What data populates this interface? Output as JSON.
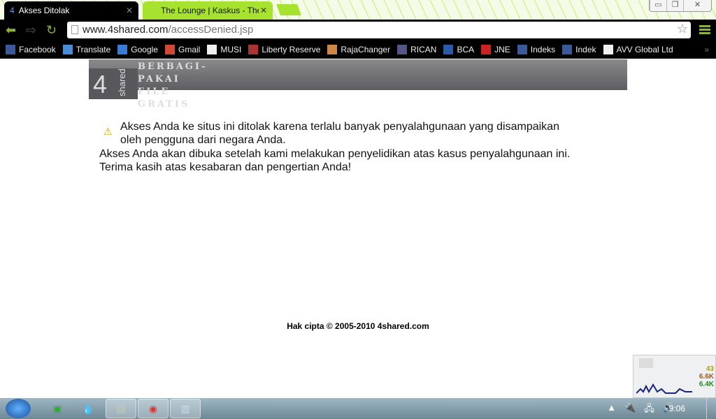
{
  "browser": {
    "tabs": [
      {
        "label": "Akses Ditolak",
        "active": true
      },
      {
        "label": "The Lounge | Kaskus - The",
        "active": false
      }
    ],
    "url_host": "www.4shared.com",
    "url_path": "/accessDenied.jsp",
    "bookmarks": [
      {
        "label": "Facebook",
        "icon": "facebook-icon",
        "color": "#3b5998"
      },
      {
        "label": "Translate",
        "icon": "translate-icon",
        "color": "#4a8cd8"
      },
      {
        "label": "Google",
        "icon": "google-icon",
        "color": "#3a7bd5"
      },
      {
        "label": "Gmail",
        "icon": "gmail-icon",
        "color": "#d14836"
      },
      {
        "label": "MUSI",
        "icon": "page-icon",
        "color": "#eeeeee"
      },
      {
        "label": "Liberty Reserve",
        "icon": "liberty-reserve-icon",
        "color": "#a33"
      },
      {
        "label": "RajaChanger",
        "icon": "rajachanger-icon",
        "color": "#c84"
      },
      {
        "label": "RICAN",
        "icon": "star-icon",
        "color": "#558"
      },
      {
        "label": "BCA",
        "icon": "bca-icon",
        "color": "#2a5aa8"
      },
      {
        "label": "JNE",
        "icon": "jne-icon",
        "color": "#c22"
      },
      {
        "label": "Indeks",
        "icon": "facebook-icon",
        "color": "#3b5998"
      },
      {
        "label": "Indek",
        "icon": "facebook-icon",
        "color": "#3b5998"
      },
      {
        "label": "AVV Global Ltd",
        "icon": "page-icon",
        "color": "#eeeeee"
      }
    ]
  },
  "page": {
    "logo": {
      "number": "4",
      "word": "shared"
    },
    "slogan": [
      "BERBAGI-",
      "PAKAI",
      "FILE",
      "GRATIS"
    ],
    "message_line1": "Akses Anda ke situs ini ditolak karena terlalu banyak penyalahgunaan yang disampaikan oleh pengguna dari negara Anda.",
    "message_line2": "Akses Anda akan dibuka setelah kami melakukan penyelidikan atas kasus penyalahgunaan ini.",
    "message_line3": "Terima kasih atas kesabaran dan pengertian Anda!",
    "footer": "Hak cipta © 2005-2010 4shared.com"
  },
  "gadget": {
    "values": [
      "43",
      "6.6K",
      "6.4K"
    ]
  },
  "taskbar": {
    "clock": "9:06"
  }
}
